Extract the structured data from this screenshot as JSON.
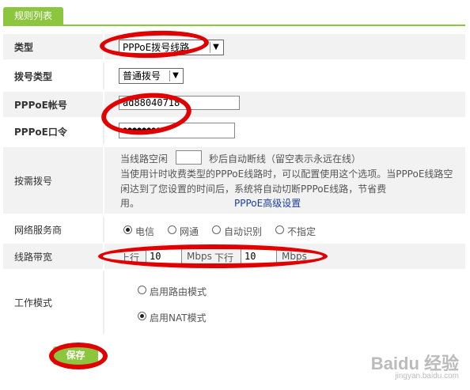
{
  "tab": {
    "label": "规则列表"
  },
  "rows": {
    "type": {
      "label": "类型",
      "value": "PPPoE拨号线路"
    },
    "dial_type": {
      "label": "拨号类型",
      "value": "普通拨号"
    },
    "account": {
      "label": "PPPoE帐号",
      "value": "ad88040718"
    },
    "password": {
      "label": "PPPoE口令",
      "value": "●●●●●●●●"
    },
    "on_demand": {
      "label": "按需拨号",
      "line1_pre": "当线路空闲",
      "line1_post": "秒后自动断线（留空表示永远在线）",
      "line2": "当使用计时收费类型的PPPoE线路时，可以配置使用这个选项。当PPPoE线路空",
      "line3": "闲达到了您设置的时间后，系统将自动切断PPPoE线路，节省费",
      "line4": "用。",
      "advanced_link": "PPPoE高级设置",
      "idle_value": ""
    },
    "isp": {
      "label": "网络服务商",
      "options": [
        "电信",
        "网通",
        "自动识别",
        "不指定"
      ],
      "selected": "电信"
    },
    "bandwidth": {
      "label": "线路带宽",
      "up_label": "上行",
      "up_value": "10",
      "unit": "Mbps",
      "down_label": "下行",
      "down_value": "10"
    },
    "work_mode": {
      "label": "工作模式",
      "options": [
        "启用路由模式",
        "启用NAT模式"
      ],
      "selected": "启用NAT模式"
    }
  },
  "save_label": "保存",
  "watermark": {
    "brand": "Baidu 经验",
    "url": "jingyan.baidu.com"
  },
  "colors": {
    "accent": "#8cc63f",
    "highlight": "#e00000",
    "link": "#1a3e9c"
  }
}
